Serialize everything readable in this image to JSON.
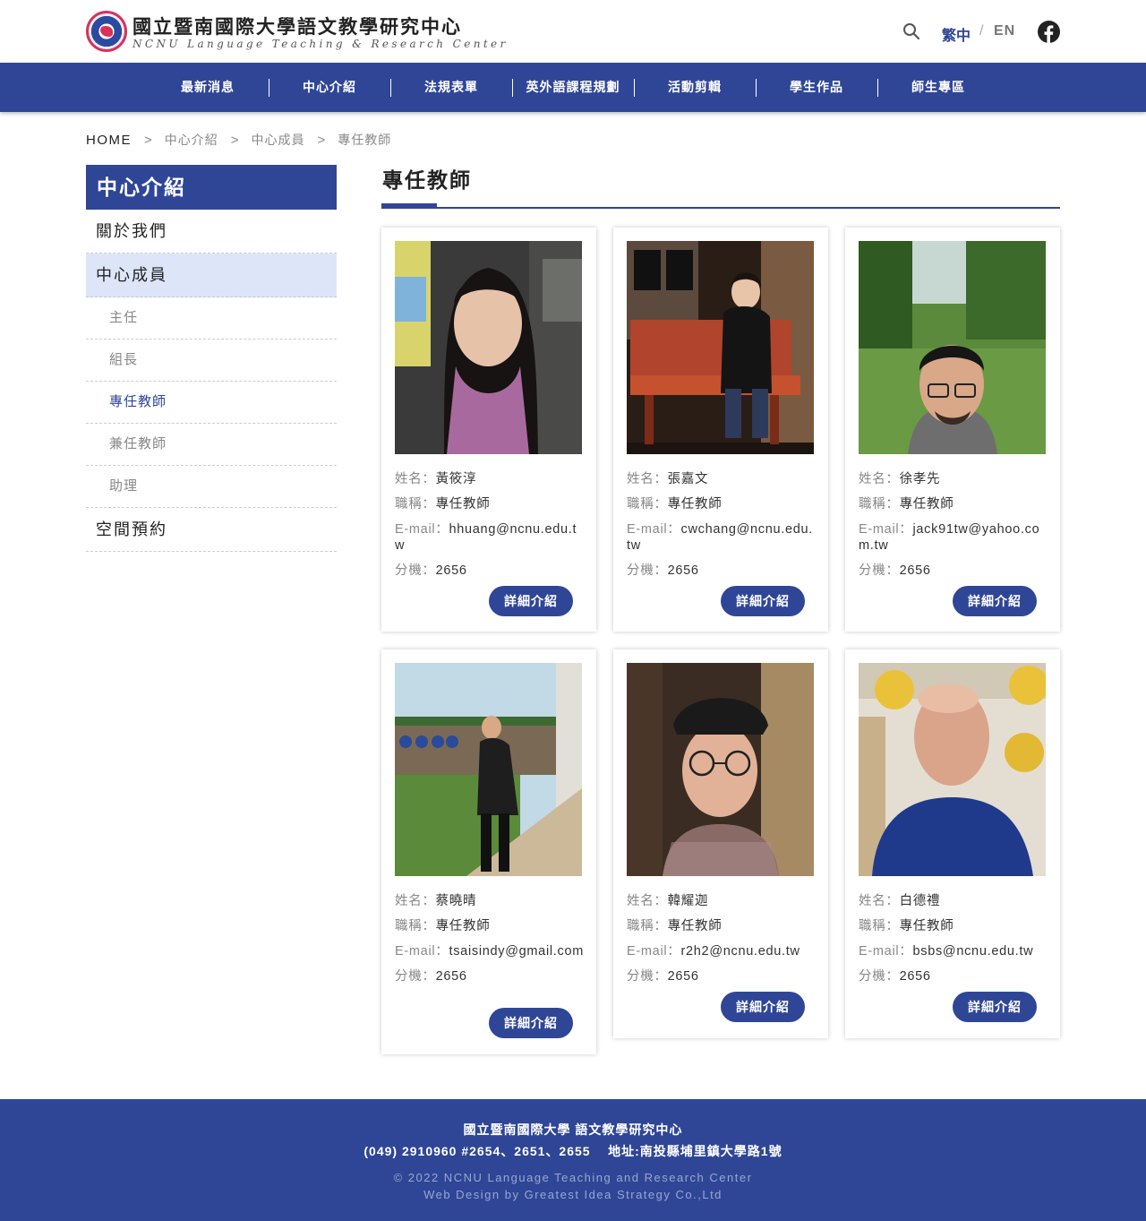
{
  "header": {
    "logo_cn": "國立暨南國際大學語文教學研究中心",
    "logo_en": "NCNU Language Teaching & Research Center",
    "lang_zh": "繁中",
    "lang_sep": "/",
    "lang_en": "EN",
    "icons": [
      "search-icon",
      "facebook-icon"
    ]
  },
  "nav": {
    "items": [
      "最新消息",
      "中心介紹",
      "法規表單",
      "英外語課程規劃",
      "活動剪輯",
      "學生作品",
      "師生專區"
    ]
  },
  "breadcrumb": {
    "home": "HOME",
    "sep": ">",
    "level1": "中心介紹",
    "level2": "中心成員",
    "level3": "專任教師"
  },
  "sidebar": {
    "title": "中心介紹",
    "items": [
      {
        "label": "關於我們"
      },
      {
        "label": "中心成員",
        "active": true
      },
      {
        "label": "主任"
      },
      {
        "label": "組長"
      },
      {
        "label": "專任教師",
        "active": true
      },
      {
        "label": "兼任教師"
      },
      {
        "label": "助理"
      },
      {
        "label": "空間預約"
      }
    ]
  },
  "main": {
    "title": "專任教師",
    "labels": {
      "name": "姓名：",
      "title": "職稱：",
      "email": "E-mail：",
      "ext": "分機："
    },
    "button_label": "詳細介紹",
    "teachers": [
      {
        "name": "黃筱淳",
        "title": "專任教師",
        "email": "hhuang@ncnu.edu.tw",
        "ext": "2656"
      },
      {
        "name": "張嘉文",
        "title": "專任教師",
        "email": "cwchang@ncnu.edu.tw",
        "ext": "2656"
      },
      {
        "name": "徐孝先",
        "title": "專任教師",
        "email": "jack91tw@yahoo.com.tw",
        "ext": "2656"
      },
      {
        "name": "蔡曉晴",
        "title": "專任教師",
        "email": "tsaisindy@gmail.com",
        "ext": "2656"
      },
      {
        "name": "韓耀迦",
        "title": "專任教師",
        "email": "r2h2@ncnu.edu.tw",
        "ext": "2656"
      },
      {
        "name": "白德禮",
        "title": "專任教師",
        "email": "bsbs@ncnu.edu.tw",
        "ext": "2656"
      }
    ]
  },
  "footer": {
    "line1": "國立暨南國際大學 語文教學研究中心",
    "line2": "(049) 2910960 #2654、2651、2655    地址:南投縣埔里鎮大學路1號",
    "line3": "© 2022 NCNU Language Teaching and Research Center",
    "line4": "Web Design by Greatest Idea Strategy Co.,Ltd"
  },
  "colors": {
    "brand": "#2f4697",
    "sidebar_active_bg": "#dde6f9",
    "muted_text": "#888888"
  }
}
